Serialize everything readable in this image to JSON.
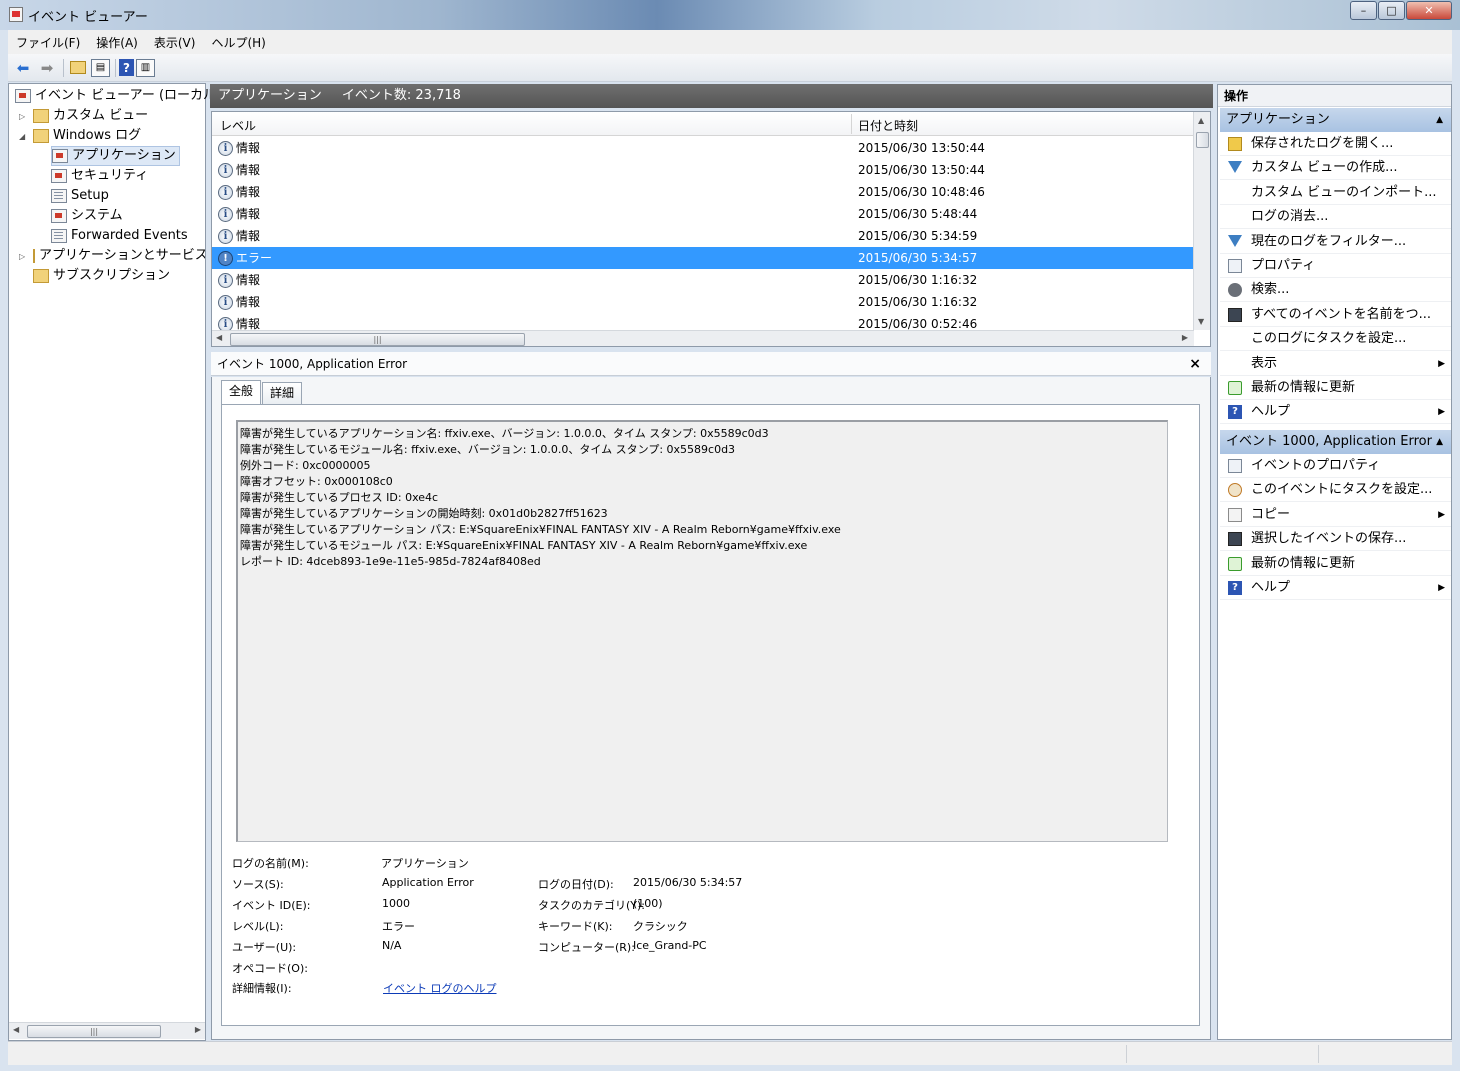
{
  "window": {
    "title": "イベント ビューアー",
    "controls": {
      "minimize": "–",
      "maximize": "□",
      "close": "✕"
    }
  },
  "menu": [
    "ファイル(F)",
    "操作(A)",
    "表示(V)",
    "ヘルプ(H)"
  ],
  "tree": {
    "root": "イベント ビューアー (ローカル)",
    "custom_views": "カスタム ビュー",
    "windows_logs": "Windows ログ",
    "logs": [
      "アプリケーション",
      "セキュリティ",
      "Setup",
      "システム",
      "Forwarded Events"
    ],
    "apps_services": "アプリケーションとサービス ログ",
    "subscriptions": "サブスクリプション"
  },
  "center_header": {
    "log_name": "アプリケーション",
    "event_count": "イベント数: 23,718"
  },
  "event_list": {
    "columns": [
      "レベル",
      "日付と時刻"
    ],
    "rows": [
      {
        "level": "情報",
        "datetime": "2015/06/30 13:50:44",
        "type": "info"
      },
      {
        "level": "情報",
        "datetime": "2015/06/30 13:50:44",
        "type": "info"
      },
      {
        "level": "情報",
        "datetime": "2015/06/30 10:48:46",
        "type": "info"
      },
      {
        "level": "情報",
        "datetime": "2015/06/30 5:48:44",
        "type": "info"
      },
      {
        "level": "情報",
        "datetime": "2015/06/30 5:34:59",
        "type": "info"
      },
      {
        "level": "エラー",
        "datetime": "2015/06/30 5:34:57",
        "type": "error",
        "selected": true
      },
      {
        "level": "情報",
        "datetime": "2015/06/30 1:16:32",
        "type": "info"
      },
      {
        "level": "情報",
        "datetime": "2015/06/30 1:16:32",
        "type": "info"
      },
      {
        "level": "情報",
        "datetime": "2015/06/30 0:52:46",
        "type": "info"
      }
    ]
  },
  "detail": {
    "header": "イベント 1000, Application Error",
    "close": "×",
    "tabs": [
      "全般",
      "詳細"
    ],
    "message_lines": [
      "障害が発生しているアプリケーション名: ffxiv.exe、バージョン: 1.0.0.0、タイム スタンプ: 0x5589c0d3",
      "障害が発生しているモジュール名: ffxiv.exe、バージョン: 1.0.0.0、タイム スタンプ: 0x5589c0d3",
      "例外コード: 0xc0000005",
      "障害オフセット: 0x000108c0",
      "障害が発生しているプロセス ID: 0xe4c",
      "障害が発生しているアプリケーションの開始時刻: 0x01d0b2827ff51623",
      "障害が発生しているアプリケーション パス: E:¥SquareEnix¥FINAL FANTASY XIV - A Realm Reborn¥game¥ffxiv.exe",
      "障害が発生しているモジュール パス: E:¥SquareEnix¥FINAL FANTASY XIV - A Realm Reborn¥game¥ffxiv.exe",
      "レポート ID: 4dceb893-1e9e-11e5-985d-7824af8408ed"
    ],
    "props": {
      "log_name_label": "ログの名前(M):",
      "log_name": "アプリケーション",
      "source_label": "ソース(S):",
      "source": "Application Error",
      "logged_label": "ログの日付(D):",
      "logged": "2015/06/30 5:34:57",
      "event_id_label": "イベント ID(E):",
      "event_id": "1000",
      "task_label": "タスクのカテゴリ(Y):",
      "task": "(100)",
      "level_label": "レベル(L):",
      "level": "エラー",
      "keywords_label": "キーワード(K):",
      "keywords": "クラシック",
      "user_label": "ユーザー(U):",
      "user": "N/A",
      "computer_label": "コンピューター(R):",
      "computer": "Ice_Grand-PC",
      "opcode_label": "オペコード(O):",
      "more_info_label": "詳細情報(I):",
      "more_info_link": "イベント ログのヘルプ"
    }
  },
  "actions": {
    "title": "操作",
    "section1": "アプリケーション",
    "items1": [
      {
        "label": "保存されたログを開く...",
        "icon": "open-folder-icon"
      },
      {
        "label": "カスタム ビューの作成...",
        "icon": "filter-icon"
      },
      {
        "label": "カスタム ビューのインポート...",
        "icon": ""
      },
      {
        "label": "ログの消去...",
        "icon": ""
      },
      {
        "label": "現在のログをフィルター...",
        "icon": "filter-icon"
      },
      {
        "label": "プロパティ",
        "icon": "properties-icon"
      },
      {
        "label": "検索...",
        "icon": "binoculars-icon"
      },
      {
        "label": "すべてのイベントを名前をつ...",
        "icon": "save-icon"
      },
      {
        "label": "このログにタスクを設定...",
        "icon": ""
      },
      {
        "label": "表示",
        "icon": "",
        "submenu": true
      },
      {
        "label": "最新の情報に更新",
        "icon": "refresh-icon"
      },
      {
        "label": "ヘルプ",
        "icon": "help-icon",
        "submenu": true
      }
    ],
    "section2": "イベント 1000, Application Error",
    "items2": [
      {
        "label": "イベントのプロパティ",
        "icon": "properties-icon"
      },
      {
        "label": "このイベントにタスクを設定...",
        "icon": "task-icon"
      },
      {
        "label": "コピー",
        "icon": "copy-icon",
        "submenu": true
      },
      {
        "label": "選択したイベントの保存...",
        "icon": "save-icon"
      },
      {
        "label": "最新の情報に更新",
        "icon": "refresh-icon"
      },
      {
        "label": "ヘルプ",
        "icon": "help-icon",
        "submenu": true
      }
    ]
  },
  "colors": {
    "selection": "#3399ff",
    "section_header": "#b7cce8"
  }
}
